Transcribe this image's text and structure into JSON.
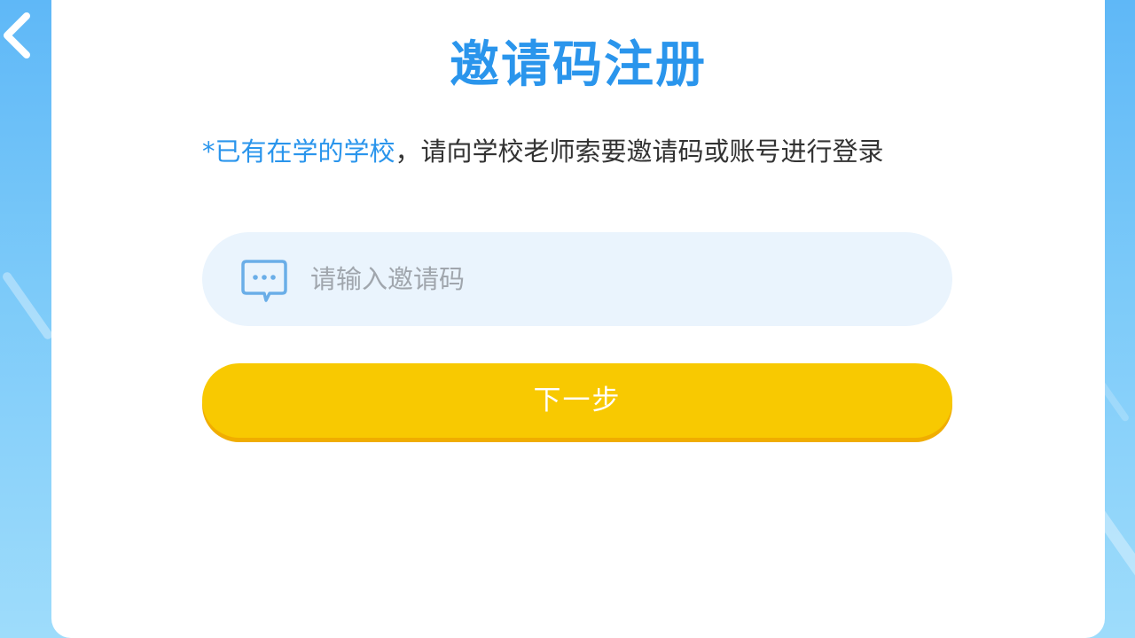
{
  "header": {
    "back_icon": "chevron-left-icon",
    "title": "邀请码注册"
  },
  "notice": {
    "highlight": "*已有在学的学校",
    "text": "，请向学校老师索要邀请码或账号进行登录"
  },
  "form": {
    "input_icon": "chat-bubble-icon",
    "placeholder": "请输入邀请码",
    "value": "",
    "next_label": "下一步"
  },
  "colors": {
    "accent_blue": "#2a95ec",
    "button_yellow": "#f8c901",
    "input_bg": "#eaf4fd",
    "background_blue": "#5fb8f7"
  }
}
